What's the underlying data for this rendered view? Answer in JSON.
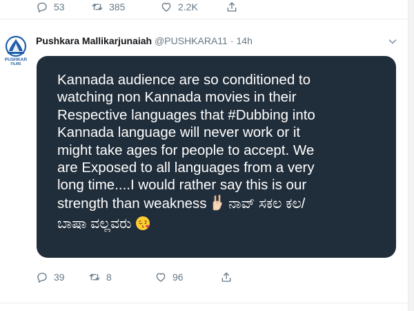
{
  "previous_tweet": {
    "reply_count": "53",
    "retweet_count": "385",
    "like_count": "2.2K"
  },
  "tweet": {
    "display_name": "Pushkara Mallikarjunaiah",
    "handle": "@PUSHKARA11",
    "separator": "·",
    "time": "14h",
    "avatar_icon": "pushkar-films-logo-icon",
    "avatar_logo_text": "PUSHKAR FILMS",
    "menu_icon": "chevron-down-icon",
    "image_text_lines": [
      "Kannada audience are so conditioned to",
      "watching non Kannada movies in their",
      "Respective languages that #Dubbing into",
      "Kannada language will never work or it",
      "might take ages for people to accept.  We",
      "are Exposed to all languages from a very",
      "long time....I would rather say this is our",
      "strength than weakness",
      "ನಾವ್ ಸಕಲ ಕಲ/",
      "ಬಾಷಾ ವಲ್ಲವರು"
    ],
    "image_emojis": [
      "rock-on-hand-emoji",
      "face-blowing-kiss-emoji"
    ],
    "reply_count": "39",
    "retweet_count": "8",
    "like_count": "96"
  },
  "colors": {
    "card_background": "#202d3a",
    "muted_text": "#657786",
    "divider": "#e6ecf0",
    "logo_blue": "#1f5fa8"
  }
}
